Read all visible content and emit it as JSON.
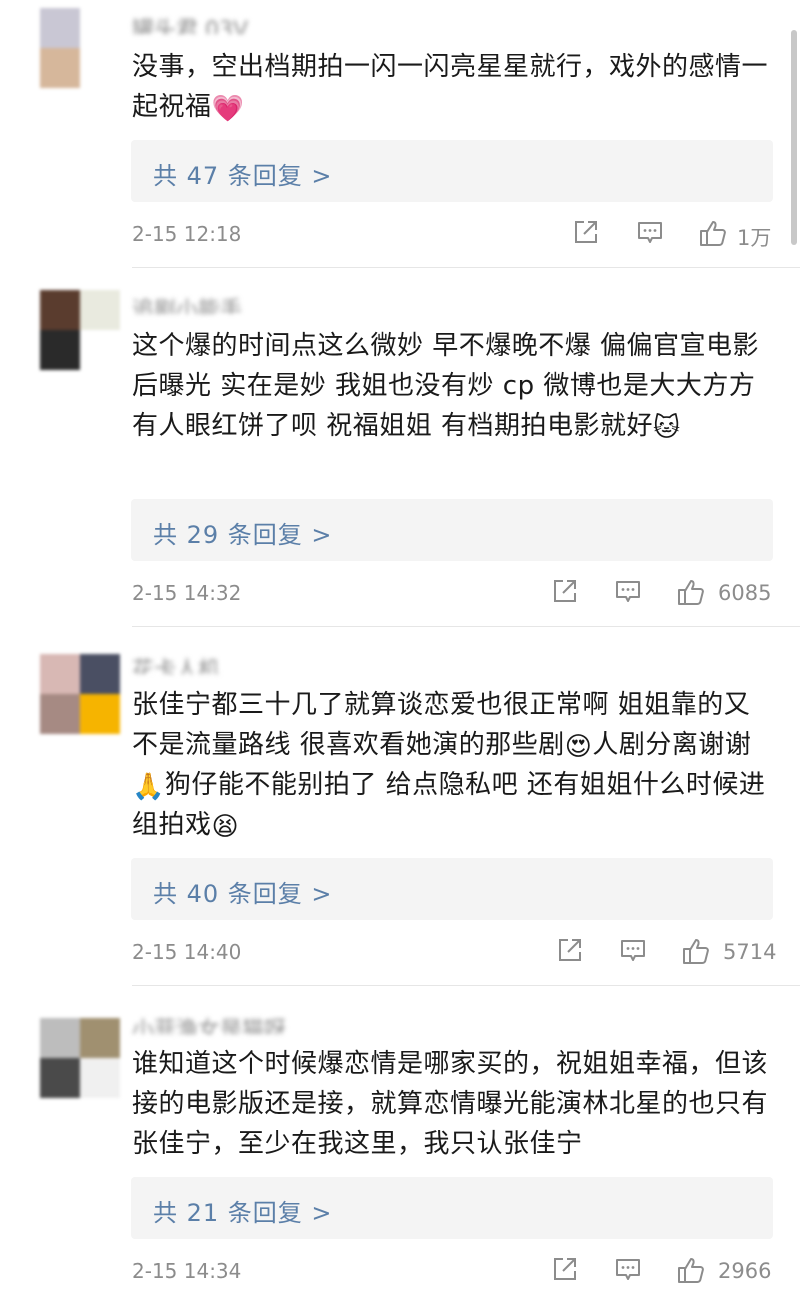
{
  "comments": [
    {
      "username": "罐头君 03V",
      "avatar_colors": [
        "#c9c7d4",
        "#ffffff",
        "#d6b79b",
        "#ffffff"
      ],
      "text": "没事，空出档期拍一闪一闪亮星星就行，戏外的感情一起祝福",
      "emoji": "💗",
      "replies_label": "共 47 条回复 >",
      "time": "2-15 12:18",
      "likes": "1万"
    },
    {
      "username": "追剧小能手",
      "avatar_colors": [
        "#5a3c2e",
        "#e9eadf",
        "#2a2a2a",
        "#ffffff"
      ],
      "text": "这个爆的时间点这么微妙 早不爆晚不爆 偏偏官宣电影后曝光 实在是妙 我姐也没有炒 cp 微博也是大大方方 有人眼红饼了呗  祝福姐姐 有档期拍电影就好",
      "emoji": "🐱",
      "replies_label": "共 29 条回复 >",
      "time": "2-15 14:32",
      "likes": "6085"
    },
    {
      "username": "花卡人机",
      "avatar_colors": [
        "#d8b8b4",
        "#4a4f63",
        "#a68a83",
        "#f6b400"
      ],
      "text_a": "张佳宁都三十几了就算谈恋爱也很正常啊 姐姐靠的又不是流量路线 很喜欢看她演的那些剧",
      "emoji_a": "😍",
      "text_b": "人剧分离谢谢",
      "emoji_b": "🙏",
      "text_c": "狗仔能不能别拍了 给点隐私吧 还有姐姐什么时候进组拍戏",
      "emoji_c": "😫",
      "replies_label": "共 40 条回复 >",
      "time": "2-15 14:40",
      "likes": "5714"
    },
    {
      "username": "小菲渔女是猫呀",
      "avatar_colors": [
        "#bdbdbd",
        "#a09070",
        "#4a4a4a",
        "#f0f0f0"
      ],
      "text": "谁知道这个时候爆恋情是哪家买的，祝姐姐幸福，但该接的电影版还是接，就算恋情曝光能演林北星的也只有张佳宁，至少在我这里，我只认张佳宁",
      "replies_label": "共 21 条回复 >",
      "time": "2-15 14:34",
      "likes": "2966"
    }
  ],
  "icons": {
    "share": "share-icon",
    "comment": "comment-icon",
    "like": "thumbs-up-icon"
  },
  "colors": {
    "reply_link": "#5b7fa8",
    "meta_text": "#8c8c8c",
    "reply_bg": "#f4f4f4"
  }
}
